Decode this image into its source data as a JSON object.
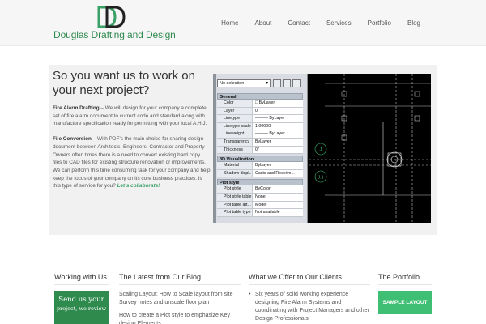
{
  "site": {
    "logo_text": "Douglas Drafting and Design",
    "brand_color": "#2f8a4f"
  },
  "nav": {
    "items": [
      "Home",
      "About",
      "Contact",
      "Services",
      "Portfolio",
      "Blog"
    ]
  },
  "hero": {
    "title": "So you want us to work on your next project?",
    "p1_lead": "Fire Alarm Drafting",
    "p1_body": " – We will design for your company a complete set of fire alarm document to current code and standard along with manufacture specification ready for permitting with your local A.H.J.",
    "p2_lead": "File Conversion",
    "p2_body": " – With PDF’s the main choice for sharing design document between Architects, Engineers, Contractor and Property Owners often times there is a need to convert existing hard copy files to CAD files for existing structure renovation or improvements. We can perform this time consuming task for your company and help keep the focus of your company on its core business practices. Is this type of service for you? ",
    "cta": "Let’s collaborate!"
  },
  "cad": {
    "selection": "No selection",
    "sections": [
      {
        "name": "General",
        "rows": [
          [
            "Color",
            "□ ByLayer"
          ],
          [
            "Layer",
            "0"
          ],
          [
            "Linetype",
            "——— ByLayer"
          ],
          [
            "Linetype scale",
            "1.00000"
          ],
          [
            "Lineweight",
            "——— ByLayer"
          ],
          [
            "Transparency",
            "ByLayer"
          ],
          [
            "Thickness",
            "0\""
          ]
        ]
      },
      {
        "name": "3D Visualization",
        "rows": [
          [
            "Material",
            "ByLayer"
          ],
          [
            "Shadow displ...",
            "Casts and Receive..."
          ]
        ]
      },
      {
        "name": "Plot style",
        "rows": [
          [
            "Plot style",
            "ByColor"
          ],
          [
            "Plot style table",
            "None"
          ],
          [
            "Plot table att...",
            "Model"
          ],
          [
            "Plot table type",
            "Not available"
          ]
        ]
      }
    ],
    "grid_labels": [
      "J",
      "J.1"
    ]
  },
  "columns": {
    "working_title": "Working with Us",
    "blog_title": "The Latest from Our Blog",
    "offer_title": "What we Offer to Our Clients",
    "portfolio_title": "The Portfolio"
  },
  "ad": {
    "line1": "Send us your",
    "line2": "project, we review"
  },
  "blog": {
    "posts": [
      "Scaling Layout: How to Scale layout from site Survey notes and unscale floor plan",
      "How to create a Plot style to emphasize Key design Elements"
    ]
  },
  "offer": {
    "items": [
      "Six years of solid working experience designing Fire Alarm Systems and coordinating with Project Managers and other Design Professionals."
    ]
  },
  "portfolio": {
    "tile_label": "SAMPLE LAYOUT"
  }
}
